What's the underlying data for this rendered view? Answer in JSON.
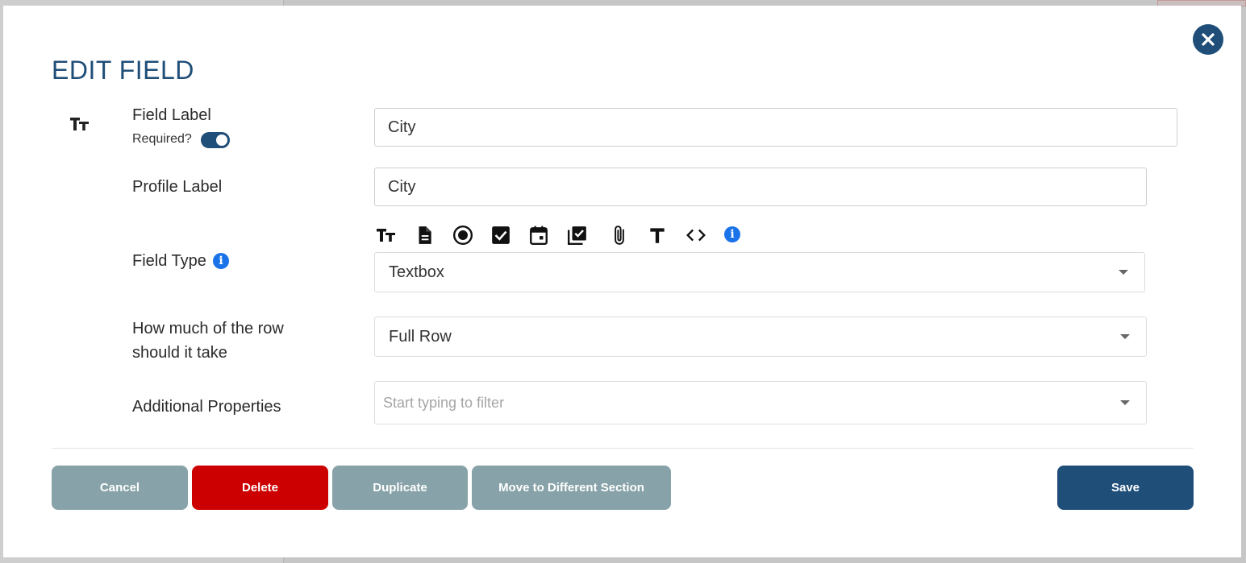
{
  "modal": {
    "title": "EDIT FIELD"
  },
  "fields": {
    "field_label": {
      "label": "Field Label",
      "value": "City",
      "required_label": "Required?",
      "required": true
    },
    "profile_label": {
      "label": "Profile Label",
      "value": "City"
    },
    "field_type": {
      "label": "Field Type",
      "selected": "Textbox",
      "type_icons": [
        "text-size-icon",
        "document-icon",
        "radio-icon",
        "checkbox-icon",
        "calendar-icon",
        "checklist-icon",
        "paperclip-icon",
        "text-icon",
        "code-icon",
        "info-icon"
      ]
    },
    "row_width": {
      "label_line1": "How much of the row",
      "label_line2": "should it take",
      "selected": "Full Row"
    },
    "additional_properties": {
      "label": "Additional Properties",
      "placeholder": "Start typing to filter"
    }
  },
  "buttons": {
    "cancel": "Cancel",
    "delete": "Delete",
    "duplicate": "Duplicate",
    "move": "Move to Different Section",
    "save": "Save"
  },
  "colors": {
    "primary": "#1f4e79",
    "danger": "#cc0000",
    "secondary": "#87a2a8",
    "info": "#1a73e8"
  }
}
